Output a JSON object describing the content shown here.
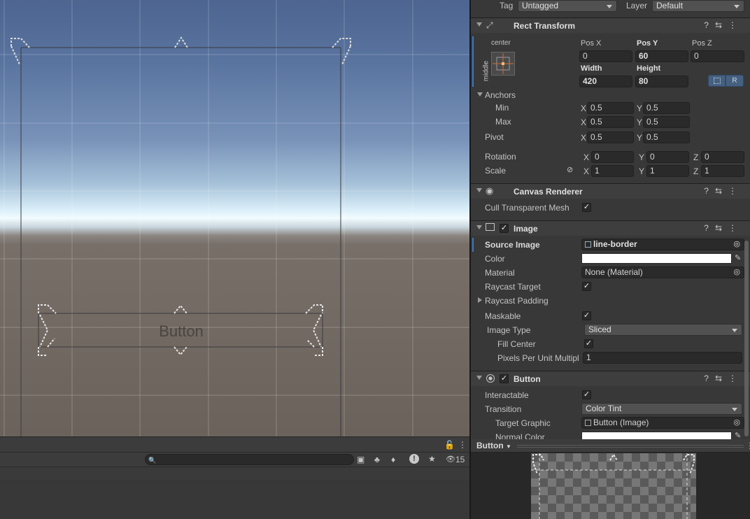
{
  "scene": {
    "button_text": "Button"
  },
  "console": {
    "count": "15"
  },
  "inspector": {
    "tag_label": "Tag",
    "tag_value": "Untagged",
    "layer_label": "Layer",
    "layer_value": "Default",
    "rect_transform": {
      "title": "Rect Transform",
      "anchor_h": "center",
      "anchor_v": "middle",
      "pos_x_label": "Pos X",
      "pos_y_label": "Pos Y",
      "pos_z_label": "Pos Z",
      "pos_x": "0",
      "pos_y": "60",
      "pos_z": "0",
      "width_label": "Width",
      "height_label": "Height",
      "width": "420",
      "height": "80",
      "raw_button": "R",
      "anchors_label": "Anchors",
      "min_label": "Min",
      "min_x": "0.5",
      "min_y": "0.5",
      "max_label": "Max",
      "max_x": "0.5",
      "max_y": "0.5",
      "pivot_label": "Pivot",
      "pivot_x": "0.5",
      "pivot_y": "0.5",
      "rotation_label": "Rotation",
      "rot_x": "0",
      "rot_y": "0",
      "rot_z": "0",
      "scale_label": "Scale",
      "scale_x": "1",
      "scale_y": "1",
      "scale_z": "1",
      "x": "X",
      "y": "Y",
      "z": "Z"
    },
    "canvas_renderer": {
      "title": "Canvas Renderer",
      "cull_label": "Cull Transparent Mesh"
    },
    "image": {
      "title": "Image",
      "source_label": "Source Image",
      "source_value": "line-border",
      "color_label": "Color",
      "material_label": "Material",
      "material_value": "None (Material)",
      "raycast_label": "Raycast Target",
      "padding_label": "Raycast Padding",
      "maskable_label": "Maskable",
      "type_label": "Image Type",
      "type_value": "Sliced",
      "fill_label": "Fill Center",
      "ppu_label": "Pixels Per Unit Multipl",
      "ppu_value": "1"
    },
    "button": {
      "title": "Button",
      "interactable_label": "Interactable",
      "transition_label": "Transition",
      "transition_value": "Color Tint",
      "target_label": "Target Graphic",
      "target_value": "Button (Image)",
      "normal_label": "Normal Color"
    }
  },
  "preview": {
    "tab_label": "Button"
  },
  "colors": {
    "accent": "#3b79c4",
    "image_color": "#ffffff"
  }
}
